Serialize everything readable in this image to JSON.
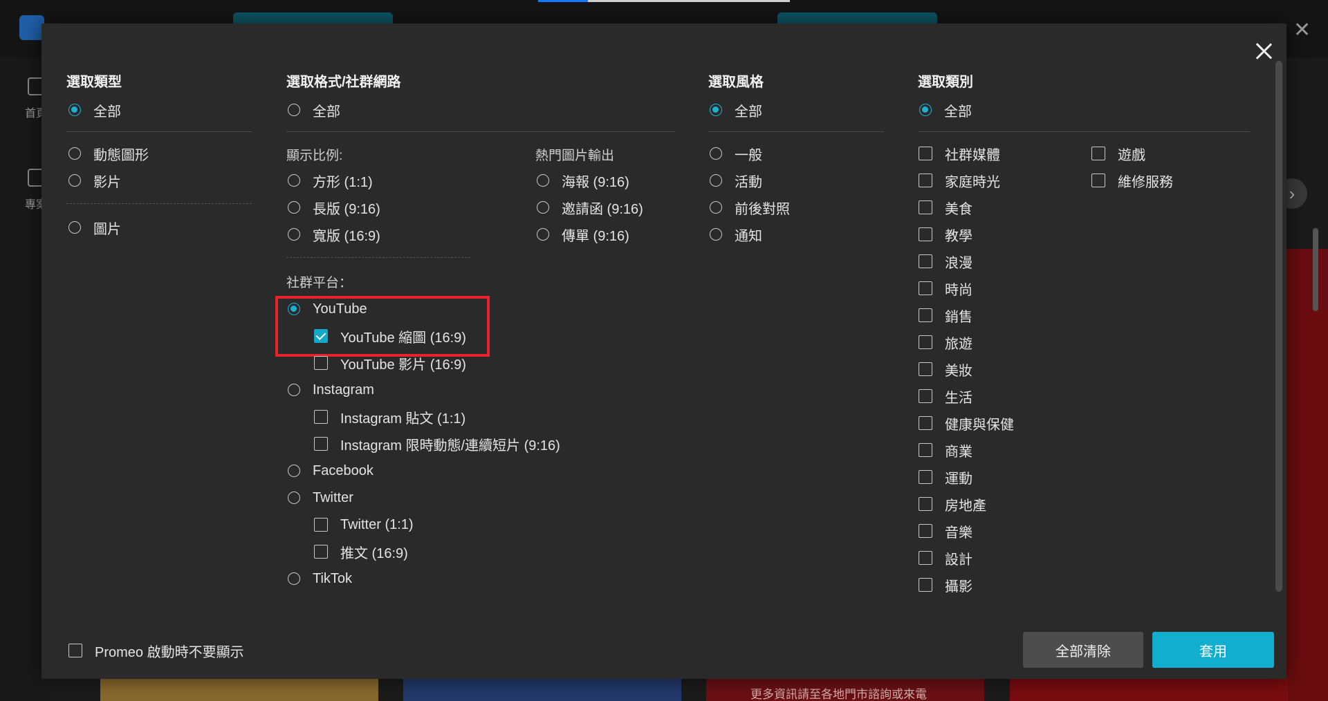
{
  "background": {
    "sidebar_home": "首頁",
    "sidebar_projects": "專案",
    "card_text": "更多資訊請至各地門市諮詢或來電"
  },
  "modal": {
    "columns": {
      "type": {
        "title": "選取類型",
        "all": "全部",
        "options": [
          "動態圖形",
          "影片",
          "圖片"
        ],
        "selected": "全部"
      },
      "format": {
        "title": "選取格式/社群網路",
        "all": "全部",
        "ratio_title": "顯示比例:",
        "ratios": [
          "方形 (1:1)",
          "長版 (9:16)",
          "寬版 (16:9)"
        ],
        "popular_title": "熱門圖片輸出",
        "popular": [
          "海報 (9:16)",
          "邀請函 (9:16)",
          "傳單 (9:16)"
        ],
        "social_title": "社群平台：",
        "platforms": [
          {
            "name": "YouTube",
            "selected": true,
            "subs": [
              {
                "label": "YouTube 縮圖 (16:9)",
                "checked": true
              },
              {
                "label": "YouTube 影片 (16:9)",
                "checked": false
              }
            ]
          },
          {
            "name": "Instagram",
            "selected": false,
            "subs": [
              {
                "label": "Instagram 貼文 (1:1)",
                "checked": false
              },
              {
                "label": "Instagram 限時動態/連續短片 (9:16)",
                "checked": false
              }
            ]
          },
          {
            "name": "Facebook",
            "selected": false,
            "subs": []
          },
          {
            "name": "Twitter",
            "selected": false,
            "subs": [
              {
                "label": "Twitter (1:1)",
                "checked": false
              },
              {
                "label": "推文 (16:9)",
                "checked": false
              }
            ]
          },
          {
            "name": "TikTok",
            "selected": false,
            "subs": []
          }
        ]
      },
      "style": {
        "title": "選取風格",
        "all": "全部",
        "options": [
          "一般",
          "活動",
          "前後對照",
          "通知"
        ],
        "selected": "全部"
      },
      "category": {
        "title": "選取類別",
        "all": "全部",
        "col1": [
          "社群媒體",
          "家庭時光",
          "美食",
          "教學",
          "浪漫",
          "時尚",
          "銷售",
          "旅遊",
          "美妝",
          "生活",
          "健康與保健",
          "商業",
          "運動",
          "房地產",
          "音樂",
          "設計",
          "攝影"
        ],
        "col2": [
          "遊戲",
          "維修服務"
        ]
      }
    },
    "footer": {
      "dont_show": "Promeo 啟動時不要顯示",
      "clear_all": "全部清除",
      "apply": "套用"
    },
    "colors": {
      "accent": "#13aecf",
      "highlight": "#e8232b",
      "panel": "#2a2a2a"
    }
  }
}
